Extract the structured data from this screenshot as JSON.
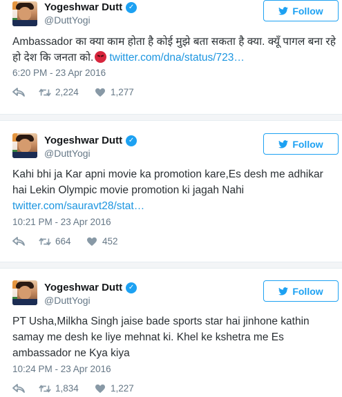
{
  "tweets": [
    {
      "author": "Yogeshwar Dutt",
      "handle": "@DuttYogi",
      "follow_label": "Follow",
      "text": "Ambassador का क्या काम होता है कोई मुझे बता सकता है क्या. क्यूँ पागल बना रहे हो देश कि जनता को.",
      "emoji": "angry-face",
      "link": "twitter.com/dna/status/723…",
      "timestamp": "6:20 PM - 23 Apr 2016",
      "retweets": "2,224",
      "likes": "1,277"
    },
    {
      "author": "Yogeshwar Dutt",
      "handle": "@DuttYogi",
      "follow_label": "Follow",
      "text": "Kahi bhi ja Kar apni movie ka promotion kare,Es desh me adhikar hai Lekin Olympic movie promotion ki jagah Nahi",
      "link": "twitter.com/sauravt28/stat…",
      "timestamp": "10:21 PM - 23 Apr 2016",
      "retweets": "664",
      "likes": "452"
    },
    {
      "author": "Yogeshwar Dutt",
      "handle": "@DuttYogi",
      "follow_label": "Follow",
      "text": "PT Usha,Milkha Singh jaise bade sports star hai jinhone kathin samay me desh ke liye mehnat ki. Khel ke kshetra me Es ambassador ne Kya kiya",
      "timestamp": "10:24 PM - 23 Apr 2016",
      "retweets": "1,834",
      "likes": "1,227"
    }
  ],
  "colors": {
    "accent": "#1da1f2",
    "link": "#1b95e0",
    "muted": "#657786",
    "text": "#292f33"
  },
  "icons": [
    "verified-badge-icon",
    "twitter-bird-icon",
    "reply-icon",
    "retweet-icon",
    "heart-icon",
    "angry-face-emoji"
  ]
}
